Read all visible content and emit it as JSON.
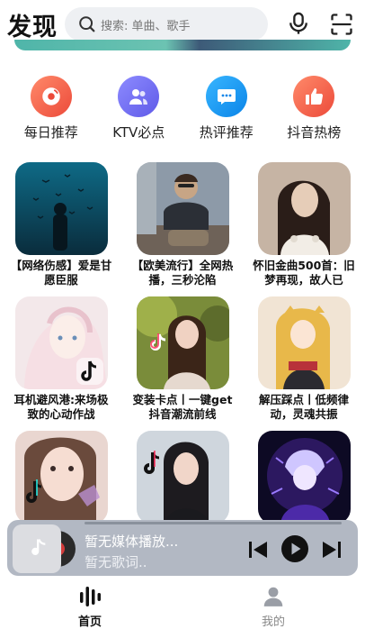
{
  "header": {
    "title": "发现",
    "search_placeholder": "搜索: 单曲、歌手",
    "mic_icon": "microphone-icon",
    "scan_icon": "scan-icon"
  },
  "quick_nav": [
    {
      "label": "每日推荐",
      "icon": "disc-icon",
      "color": "#f0624a"
    },
    {
      "label": "KTV必点",
      "icon": "users-icon",
      "color": "#6f6cf0"
    },
    {
      "label": "热评推荐",
      "icon": "chat-bubble-icon",
      "color": "#1c9af0"
    },
    {
      "label": "抖音热榜",
      "icon": "thumbs-up-icon",
      "color": "#f0624a"
    }
  ],
  "playlists": [
    {
      "title": "【网络伤感】爱是甘愿臣服"
    },
    {
      "title": "【欧美流行】全网热播，三秒沦陷"
    },
    {
      "title": "怀旧金曲500首：旧梦再现，故人已"
    },
    {
      "title": "耳机避风港:来场极致的心动作战"
    },
    {
      "title": "变装卡点丨一键get抖音潮流前线"
    },
    {
      "title": "解压踩点丨低频律动，灵魂共振"
    },
    {
      "title": ""
    },
    {
      "title": ""
    },
    {
      "title": ""
    }
  ],
  "player": {
    "title": "暂无媒体播放...",
    "lyric": "暂无歌词..",
    "progress": 0
  },
  "tabs": [
    {
      "label": "首页",
      "icon": "equalizer-icon",
      "active": true
    },
    {
      "label": "我的",
      "icon": "person-icon",
      "active": false
    }
  ],
  "colors": {
    "accent": "#f0624a",
    "player_bg": "#b2b8c3",
    "search_bg": "#eef0f3"
  }
}
